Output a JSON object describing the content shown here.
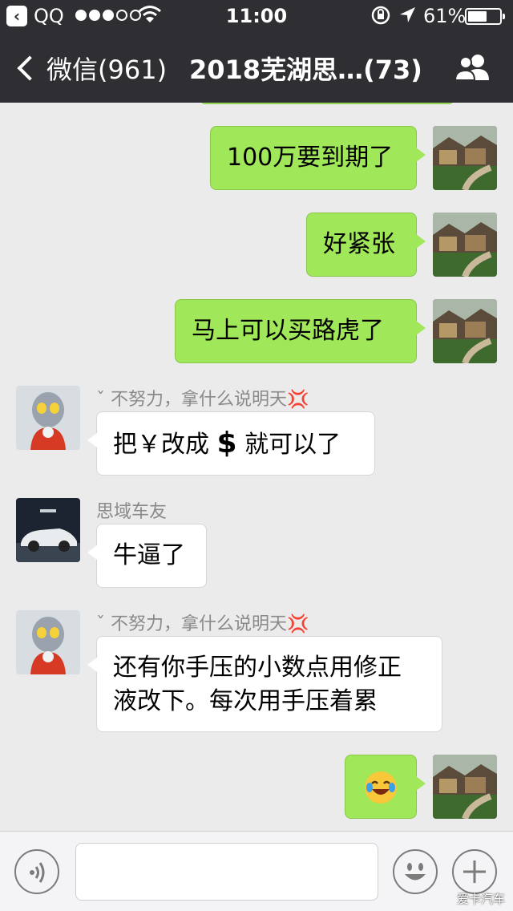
{
  "status_bar": {
    "back_app_label": "QQ",
    "time": "11:00",
    "battery_percent": "61%",
    "battery_level": 0.61,
    "signal_bars": 3,
    "signal_total": 5
  },
  "nav": {
    "back_label": "微信(961)",
    "title": "2018芜湖思…(73)",
    "people_icon": "group-icon"
  },
  "messages": [
    {
      "side": "me",
      "text": "100万要到期了"
    },
    {
      "side": "me",
      "text": "好紧张"
    },
    {
      "side": "me",
      "text": "马上可以买路虎了"
    },
    {
      "side": "other",
      "sender": "ˇ 不努力，拿什么说明天",
      "sender_emoji": "💢",
      "text_before": "把￥改成",
      "text_symbol": "$",
      "text_after": " 就可以了"
    },
    {
      "side": "other",
      "sender": "思域车友",
      "text": "牛逼了"
    },
    {
      "side": "other",
      "sender": "ˇ 不努力，拿什么说明天",
      "sender_emoji": "💢",
      "text_line1": "还有你手压的小数点用修正",
      "text_line2": "液改下。每次用手压着累"
    },
    {
      "side": "me",
      "emoji": "laughing-crying-emoji"
    }
  ],
  "input_bar": {
    "placeholder": "",
    "voice_icon": "voice-icon",
    "emoji_icon": "smiley-icon",
    "plus_icon": "plus-icon"
  },
  "watermark": "爱卡汽车"
}
